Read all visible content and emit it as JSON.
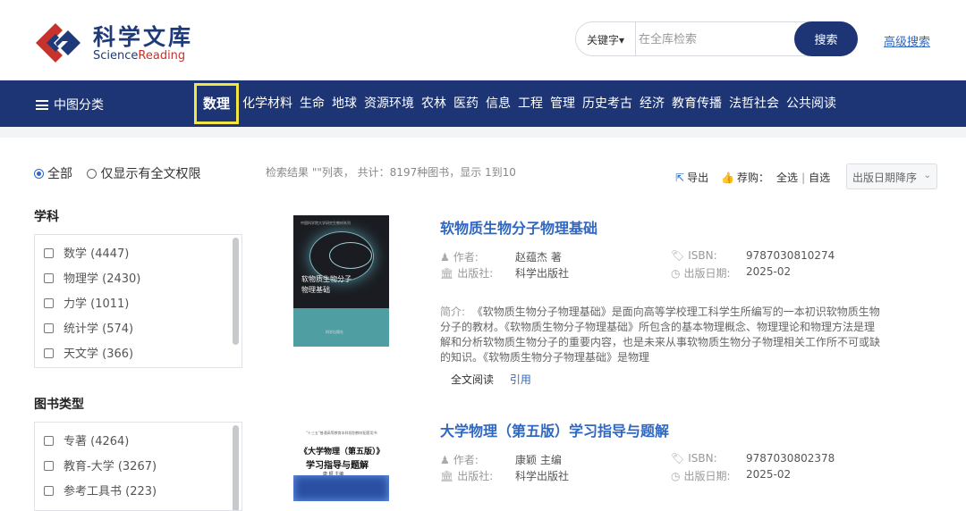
{
  "brand": {
    "name_cn": "科学文库",
    "name_en_prefix": "Science",
    "name_en_suffix": "Reading"
  },
  "search": {
    "field": "关键字▾",
    "placeholder": "在全库检索",
    "button": "搜索",
    "advanced": "高级搜索"
  },
  "nav": {
    "menu_label": "中图分类",
    "items": [
      "数理",
      "化学材料",
      "生命",
      "地球",
      "资源环境",
      "农林",
      "医药",
      "信息",
      "工程",
      "管理",
      "历史考古",
      "经济",
      "教育传播",
      "法哲社会",
      "公共阅读"
    ],
    "active_index": 0
  },
  "filters": {
    "scope": {
      "all": "全部",
      "full_text": "仅显示有全文权限"
    },
    "subject": {
      "title": "学科",
      "items": [
        {
          "label": "数学",
          "count": "(4447)"
        },
        {
          "label": "物理学",
          "count": "(2430)"
        },
        {
          "label": "力学",
          "count": "(1011)"
        },
        {
          "label": "统计学",
          "count": "(574)"
        },
        {
          "label": "天文学",
          "count": "(366)"
        }
      ]
    },
    "book_type": {
      "title": "图书类型",
      "items": [
        {
          "label": "专著",
          "count": "(4264)"
        },
        {
          "label": "教育-大学",
          "count": "(3267)"
        },
        {
          "label": "参考工具书",
          "count": "(223)"
        }
      ]
    }
  },
  "results": {
    "summary": "检索结果 \"\"列表， 共计：8197种图书，显示 1到10",
    "export": "导出",
    "recommend": "荐购：",
    "select_all": "全选",
    "divider": "|",
    "select_self": "自选",
    "sort": "出版日期降序"
  },
  "books": [
    {
      "title": "软物质生物分子物理基础",
      "author_label": "作者:",
      "author": "赵蕴杰 著",
      "isbn_label": "ISBN:",
      "isbn": "9787030810274",
      "publisher_label": "出版社:",
      "publisher": "科学出版社",
      "date_label": "出版日期:",
      "date": "2025-02",
      "intro_label": "简介:",
      "intro": "《软物质生物分子物理基础》是面向高等学校理工科学生所编写的一本初识软物质生物分子的教材。《软物质生物分子物理基础》所包含的基本物理概念、物理理论和物理方法是理解和分析软物质生物分子的重要内容，也是未来从事软物质生物分子物理相关工作所不可或缺的知识。《软物质生物分子物理基础》是物理",
      "read": "全文阅读",
      "cite": "引用",
      "cover_title_1": "软物质生物分子",
      "cover_title_2": "物理基础",
      "cover_top": "中国科学院大学研究生教材系列",
      "cover_pub": "科学出版社"
    },
    {
      "title": "大学物理（第五版）学习指导与题解",
      "author_label": "作者:",
      "author": "康颖 主编",
      "isbn_label": "ISBN:",
      "isbn": "9787030802378",
      "publisher_label": "出版社:",
      "publisher": "科学出版社",
      "date_label": "出版日期:",
      "date": "2025-02",
      "cover_title_1": "《大学物理（第五版）》",
      "cover_title_2": "学习指导与题解",
      "cover_sub": "康 颖 主编",
      "cover_top": "\"十三五\"普通高等教育本科规划教材配套用书"
    }
  ],
  "colors": {
    "primary": "#1d3575",
    "link": "#2f67c2",
    "active_outline": "#f5e542",
    "logo_red": "#c8322d"
  }
}
